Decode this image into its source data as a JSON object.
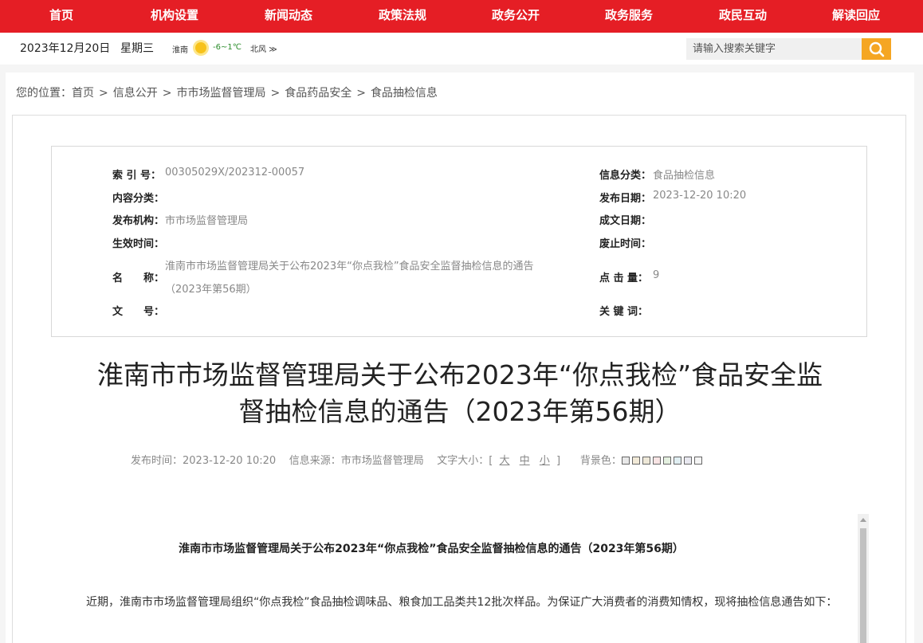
{
  "nav": {
    "items": [
      "首页",
      "机构设置",
      "新闻动态",
      "政策法规",
      "政务公开",
      "政务服务",
      "政民互动",
      "解读回应"
    ]
  },
  "info": {
    "date": "2023年12月20日",
    "weekday": "星期三",
    "city": "淮南",
    "weather_icon": "sun-icon",
    "temp": "-6~1℃",
    "wind": "北风",
    "wind_arrow": "≫"
  },
  "search": {
    "placeholder": "请输入搜索关键字"
  },
  "breadcrumb": {
    "prefix": "您的位置：",
    "items": [
      "首页",
      "信息公开",
      "市市场监督管理局",
      "食品药品安全",
      "食品抽检信息"
    ],
    "sep": ">"
  },
  "meta": {
    "index_label": "索 引 号：",
    "index_value": "00305029X/202312-00057",
    "category_label": "信息分类：",
    "category_value": "食品抽检信息",
    "content_type_label": "内容分类：",
    "content_type_value": "",
    "pub_date_label": "发布日期：",
    "pub_date_value": "2023-12-20 10:20",
    "org_label": "发布机构：",
    "org_value": "市市场监督管理局",
    "made_date_label": "成文日期：",
    "made_date_value": "",
    "effective_label": "生效时间：",
    "effective_value": "",
    "expire_label": "废止时间：",
    "expire_value": "",
    "name_label": "名　　称：",
    "name_value_line1": "淮南市市场监督管理局关于公布2023年“你点我检”食品安全监督抽检信息的通告",
    "name_value_line2": "（2023年第56期）",
    "clicks_label": "点 击 量：",
    "clicks_value": "9",
    "doc_no_label": "文　　号：",
    "doc_no_value": "",
    "keywords_label": "关 键 词：",
    "keywords_value": ""
  },
  "title": {
    "line1": "淮南市市场监督管理局关于公布2023年“你点我检”食品安全监",
    "line2": "督抽检信息的通告（2023年第56期）"
  },
  "pubbar": {
    "time_label": "发布时间：",
    "time_value": "2023-12-20 10:20",
    "source_label": "信息来源：",
    "source_value": "市市场监督管理局",
    "fontsize_label": "文字大小：[",
    "fs_large": "大",
    "fs_medium": "中",
    "fs_small": "小",
    "fontsize_end": "]",
    "bg_label": "背景色：",
    "bg_colors": [
      "#e8e8e8",
      "#f2ead8",
      "#eee8d8",
      "#f8e4e4",
      "#e4f0e0",
      "#e0eef2",
      "#e8e8f0",
      "#f5f5f5"
    ]
  },
  "article": {
    "title": "淮南市市场监督管理局关于公布2023年“你点我检”食品安全监督抽检信息的通告（2023年第56期）",
    "para": "近期，淮南市市场监督管理局组织“你点我检”食品抽检调味品、粮食加工品类共12批次样品。为保证广大消费者的消费知情权，现将抽检信息通告如下："
  }
}
